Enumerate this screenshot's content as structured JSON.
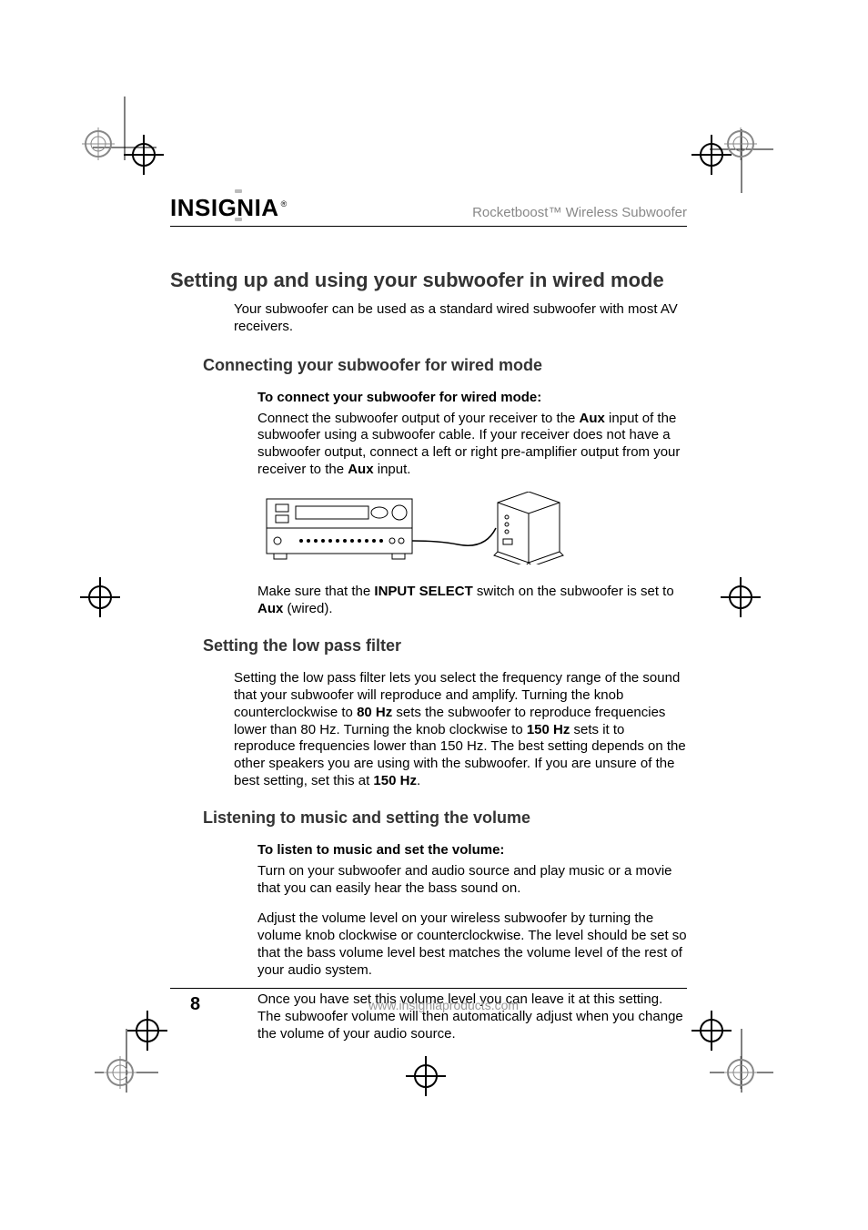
{
  "header": {
    "brand": "INSIGNIA",
    "doc_title": "Rocketboost™ Wireless Subwoofer"
  },
  "h1": "Setting up and using your subwoofer in wired mode",
  "intro": "Your subwoofer can be used as a standard wired subwoofer with most AV receivers.",
  "sec1": {
    "h2": "Connecting your subwoofer for wired mode",
    "h3": "To connect your subwoofer for wired mode:",
    "p1a": "Connect the subwoofer output of your receiver to the ",
    "p1b": "Aux",
    "p1c": " input of the subwoofer using a subwoofer cable. If your receiver does not have a subwoofer output, connect a left or right pre-amplifier output from your receiver to the ",
    "p1d": "Aux",
    "p1e": " input.",
    "p2a": "Make sure that the ",
    "p2b": "INPUT SELECT",
    "p2c": " switch on the subwoofer is set to ",
    "p2d": "Aux",
    "p2e": " (wired)."
  },
  "sec2": {
    "h2": "Setting the low pass filter",
    "p1a": "Setting the low pass filter lets you select the frequency range of the sound that your subwoofer will reproduce and amplify. Turning the knob counterclockwise to ",
    "p1b": "80 Hz",
    "p1c": " sets the subwoofer to reproduce frequencies lower than 80 Hz. Turning the knob clockwise to ",
    "p1d": "150 Hz",
    "p1e": " sets it to reproduce frequencies lower than 150 Hz. The best setting depends on the other speakers you are using with the subwoofer. If you are unsure of the best setting, set this at ",
    "p1f": "150 Hz",
    "p1g": "."
  },
  "sec3": {
    "h2": "Listening to music and setting the volume",
    "h3": "To listen to music and set the volume:",
    "p1": "Turn on your subwoofer and audio source and play music or a movie that you can easily hear the bass sound on.",
    "p2": "Adjust the volume level on your wireless subwoofer by turning the volume knob clockwise or counterclockwise. The level should be set so that the bass volume level best matches the volume level of the rest of your audio system.",
    "p3": "Once you have set this volume level you can leave it at this setting. The subwoofer volume will then automatically adjust when you change the volume of your audio source."
  },
  "footer": {
    "page": "8",
    "url": "www.insigniaproducts.com"
  }
}
